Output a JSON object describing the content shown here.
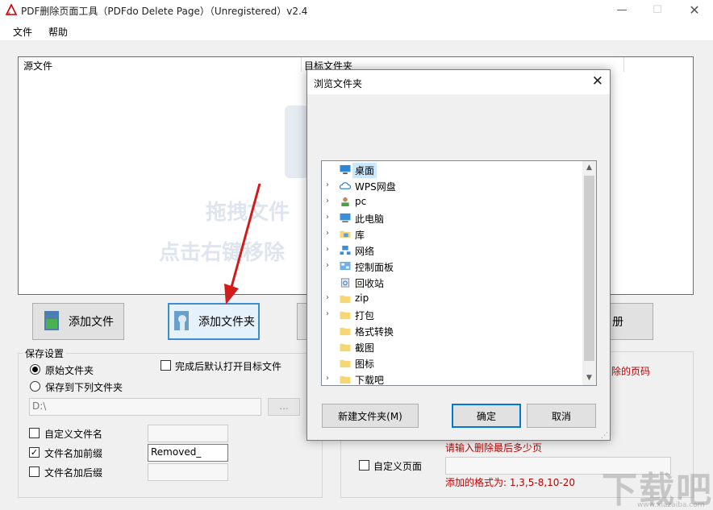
{
  "window": {
    "title": "PDF删除页面工具（PDFdo Delete Page）（Unregistered）v2.4"
  },
  "menu": {
    "file": "文件",
    "help": "帮助"
  },
  "file_list": {
    "col_source": "源文件",
    "col_target": "目标文件夹",
    "hint_line1": "拖拽文件",
    "hint_line2": "点击右键移除"
  },
  "buttons": {
    "add_file": "添加文件",
    "add_folder": "添加文件夹",
    "register": "册"
  },
  "save": {
    "group_title": "保存设置",
    "original_folder": "原始文件夹",
    "save_to_folder": "保存到下列文件夹",
    "open_after": "完成后默认打开目标文件",
    "path_value": "D:\\",
    "browse_label": "...",
    "custom_name": "自定义文件名",
    "add_prefix": "文件名加前缀",
    "prefix_value": "Removed_",
    "add_suffix": "文件名加后缀"
  },
  "pages": {
    "hint_delete": "除的页码",
    "hint_last": "请输入删除最后多少页",
    "custom_page": "自定义页面",
    "format_hint": "添加的格式为:  1,3,5-8,10-20"
  },
  "dialog": {
    "title": "浏览文件夹",
    "close": "✕",
    "tree": [
      {
        "label": "桌面",
        "icon": "desktop-icon",
        "arrow": "",
        "selected": true
      },
      {
        "label": "WPS网盘",
        "icon": "cloud-icon",
        "arrow": "›"
      },
      {
        "label": "pc",
        "icon": "user-icon",
        "arrow": "›"
      },
      {
        "label": "此电脑",
        "icon": "computer-icon",
        "arrow": "›"
      },
      {
        "label": "库",
        "icon": "library-icon",
        "arrow": "›"
      },
      {
        "label": "网络",
        "icon": "network-icon",
        "arrow": "›"
      },
      {
        "label": "控制面板",
        "icon": "control-panel-icon",
        "arrow": "›"
      },
      {
        "label": "回收站",
        "icon": "recycle-bin-icon",
        "arrow": ""
      },
      {
        "label": "zip",
        "icon": "folder-icon",
        "arrow": "›"
      },
      {
        "label": "打包",
        "icon": "folder-icon",
        "arrow": "›"
      },
      {
        "label": "格式转换",
        "icon": "folder-icon",
        "arrow": ""
      },
      {
        "label": "截图",
        "icon": "folder-icon",
        "arrow": ""
      },
      {
        "label": "图标",
        "icon": "folder-icon",
        "arrow": ""
      },
      {
        "label": "下载吧",
        "icon": "folder-icon",
        "arrow": "›"
      }
    ],
    "new_folder": "新建文件夹(M)",
    "ok": "确定",
    "cancel": "取消"
  },
  "brand": {
    "watermark": "下载吧",
    "url": "www.xiazaiba.com"
  },
  "colors": {
    "accent": "#0078d7",
    "hint_red": "#c00000",
    "selection": "#cce8ff",
    "folder": "#f7d774"
  }
}
